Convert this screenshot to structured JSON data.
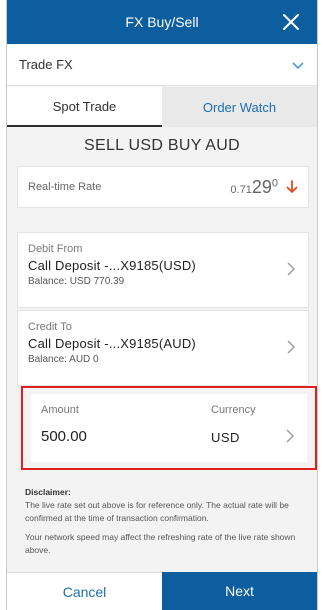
{
  "header": {
    "title": "FX Buy/Sell",
    "close_icon": "close-icon"
  },
  "trade_select": {
    "label": "Trade FX",
    "icon": "chevron-down-icon"
  },
  "tabs": [
    {
      "label": "Spot Trade",
      "active": true
    },
    {
      "label": "Order Watch",
      "active": false
    }
  ],
  "pair_title": "SELL USD BUY AUD",
  "rate": {
    "label": "Real-time Rate",
    "prefix": "0.71",
    "main": "29",
    "sup": "0",
    "trend_icon": "arrow-down-icon",
    "trend_color": "#e02020"
  },
  "debit": {
    "label": "Debit From",
    "account": "Call Deposit -...X9185(USD)",
    "balance": "Balance: USD 770.39"
  },
  "credit": {
    "label": "Credit To",
    "account": "Call Deposit -...X9185(AUD)",
    "balance": "Balance: AUD 0"
  },
  "amount": {
    "label": "Amount",
    "value": "500.00",
    "currency_label": "Currency",
    "currency": "USD"
  },
  "disclaimer": {
    "title": "Disclaimer:",
    "p1": "The live rate set out above is for reference only. The actual rate will be confirmed at the time of transaction confirmation.",
    "p2": "Your network speed may affect the refreshing rate of the live rate shown above."
  },
  "footer": {
    "cancel": "Cancel",
    "next": "Next"
  },
  "colors": {
    "brand": "#0d5e9e",
    "link": "#1b6fb3",
    "highlight": "#e02020"
  }
}
